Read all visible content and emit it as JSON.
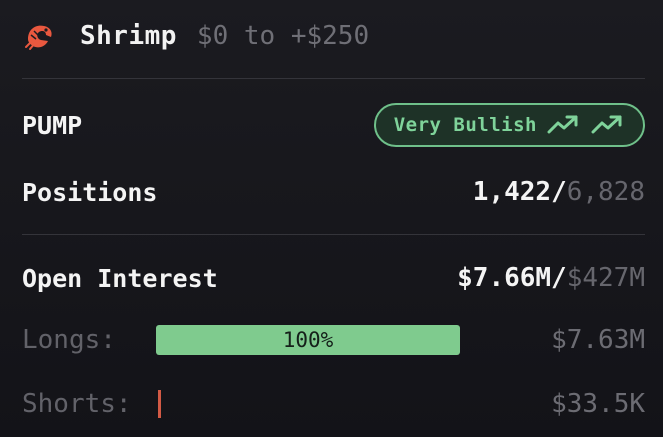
{
  "header": {
    "title": "Shrimp",
    "range": "$0 to +$250",
    "logo_icon": "shrimp-icon"
  },
  "token": {
    "symbol": "PUMP",
    "sentiment": "Very Bullish",
    "sentiment_icon": "trending-up-icon",
    "sentiment_color": "#7fd39a"
  },
  "positions": {
    "label": "Positions",
    "current": "1,422/",
    "total": "6,828"
  },
  "open_interest": {
    "label": "Open Interest",
    "current": "$7.66M/",
    "total": "$427M"
  },
  "longs": {
    "label": "Longs:",
    "percent_text": "100%",
    "fraction": 1.0,
    "value": "$7.63M",
    "color": "#7fcb8e"
  },
  "shorts": {
    "label": "Shorts:",
    "value": "$33.5K",
    "color": "#d35a45"
  }
}
